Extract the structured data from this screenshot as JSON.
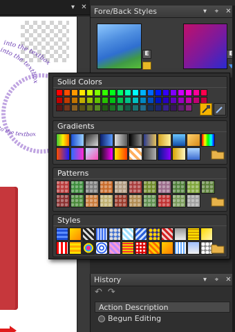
{
  "fore_back_panel": {
    "title": "Fore/Back Styles",
    "edit_label": "E"
  },
  "picker": {
    "solid_colors": {
      "title": "Solid Colors"
    },
    "gradients": {
      "title": "Gradients"
    },
    "patterns": {
      "title": "Patterns"
    },
    "styles": {
      "title": "Styles"
    }
  },
  "canvas": {
    "text_sample": "into the textbox"
  },
  "history_panel": {
    "title": "History",
    "column_header": "Action Description",
    "items": [
      {
        "label": "Begun Editing"
      }
    ]
  },
  "colors": {
    "panel_bg": "#3b3b3b",
    "accent_lock": "#e7b826",
    "selected_highlight": "#f5b400"
  }
}
